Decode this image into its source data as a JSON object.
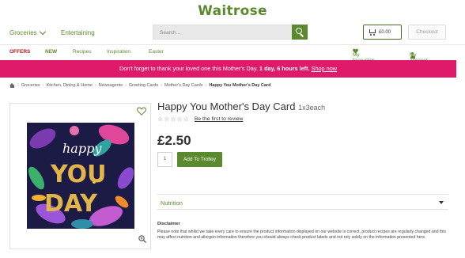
{
  "brand": {
    "name": "Waitrose",
    "color": "#5a8a2d"
  },
  "header": {
    "groceries_label": "Groceries",
    "entertaining_label": "Entertaining",
    "search_placeholder": "Search...",
    "trolley_total": "£0.00",
    "checkout_label": "Checkout"
  },
  "nav": {
    "offers": "OFFERS",
    "new": "NEW",
    "recipes": "Recipes",
    "inspiration": "Inspiration",
    "easter": "Easter",
    "favourites": "My favourites",
    "account": "My account"
  },
  "banner": {
    "text": "Don't forget to thank your loved one this Mother's Day.",
    "countdown": "1 day, 6 hours left.",
    "link": "Shop now",
    "color": "#e01a6a"
  },
  "breadcrumb": [
    "Groceries",
    "Kitchen, Dining & Home",
    "Newsagents",
    "Greeting Cards",
    "Mother's Day Cards",
    "Happy You Mother's Day Card"
  ],
  "product": {
    "title": "Happy You Mother's Day Card",
    "size": "1x3each",
    "review_link": "Be the first to review",
    "price": "£2.50",
    "quantity": "1",
    "add_button": "Add To Trolley",
    "card_text": "happy YOU DAY"
  },
  "sections": {
    "nutrition": "Nutrition",
    "disclaimer_title": "Disclaimer",
    "disclaimer_text": "Please note that whilst we take every care to ensure the product information displayed on our website is correct, product recipes are regularly changed and this may affect nutrition and allergen information therefore you should always check product labels and not rely solely on the information presented here."
  },
  "icons": [
    "chevron-down-icon",
    "search-icon",
    "trolley-icon",
    "heart-icon",
    "person-icon",
    "home-icon",
    "star-icon",
    "zoom-icon"
  ]
}
